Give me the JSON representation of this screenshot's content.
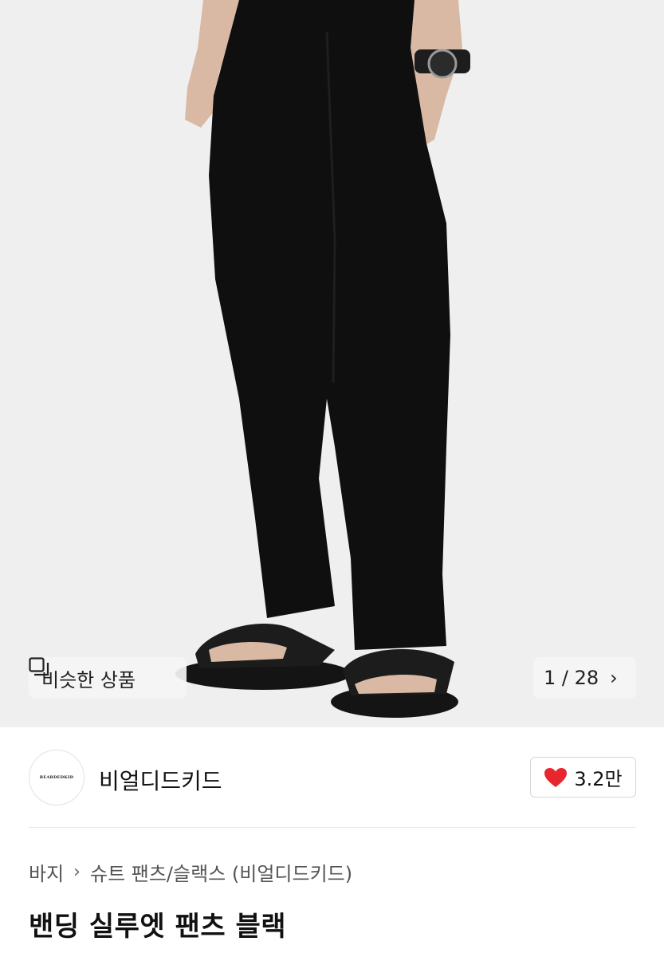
{
  "gallery": {
    "similar_label": "비슷한 상품",
    "counter": "1 / 28",
    "icons": {
      "similar": "copy-icon",
      "next": "chevron-right-icon"
    }
  },
  "seller": {
    "logo_text": "BEARDEDKID",
    "name": "비얼디드키드",
    "like_count": "3.2만",
    "icons": {
      "like": "heart-icon"
    },
    "colors": {
      "heart": "#e8262d"
    }
  },
  "breadcrumb": {
    "items": [
      "바지",
      "슈트 팬츠/슬랙스 (비얼디드키드)"
    ]
  },
  "product": {
    "title": "밴딩 실루엣 팬츠 블랙"
  }
}
